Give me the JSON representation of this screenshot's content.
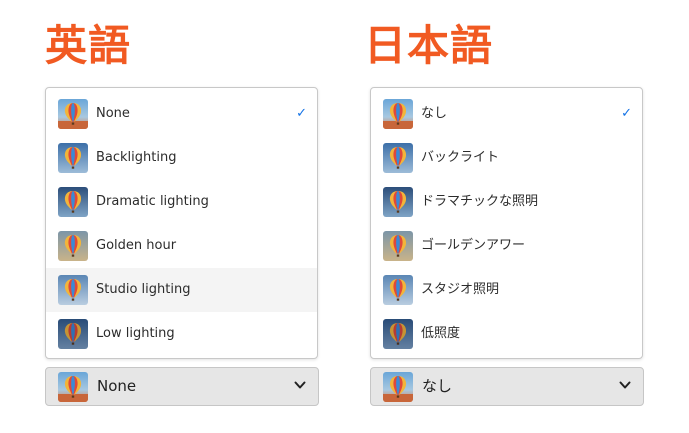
{
  "english": {
    "title": "英語",
    "items": [
      {
        "label": "None",
        "selected": true
      },
      {
        "label": "Backlighting"
      },
      {
        "label": "Dramatic lighting"
      },
      {
        "label": "Golden hour"
      },
      {
        "label": "Studio lighting",
        "highlighted": true
      },
      {
        "label": "Low lighting"
      }
    ],
    "picker_value": "None"
  },
  "japanese": {
    "title": "日本語",
    "items": [
      {
        "label": "なし",
        "selected": true
      },
      {
        "label": "バックライト"
      },
      {
        "label": "ドラマチックな照明"
      },
      {
        "label": "ゴールデンアワー"
      },
      {
        "label": "スタジオ照明"
      },
      {
        "label": "低照度"
      }
    ],
    "picker_value": "なし"
  },
  "icons": {
    "thumbnail": "hot-air-balloon-icon",
    "checkmark": "checkmark-icon",
    "chevron": "chevron-down-icon"
  },
  "colors": {
    "heading": "#f15a22",
    "checkmark": "#1473e6",
    "highlight_row": "#f4f4f4",
    "picker_background": "#e6e6e6"
  }
}
